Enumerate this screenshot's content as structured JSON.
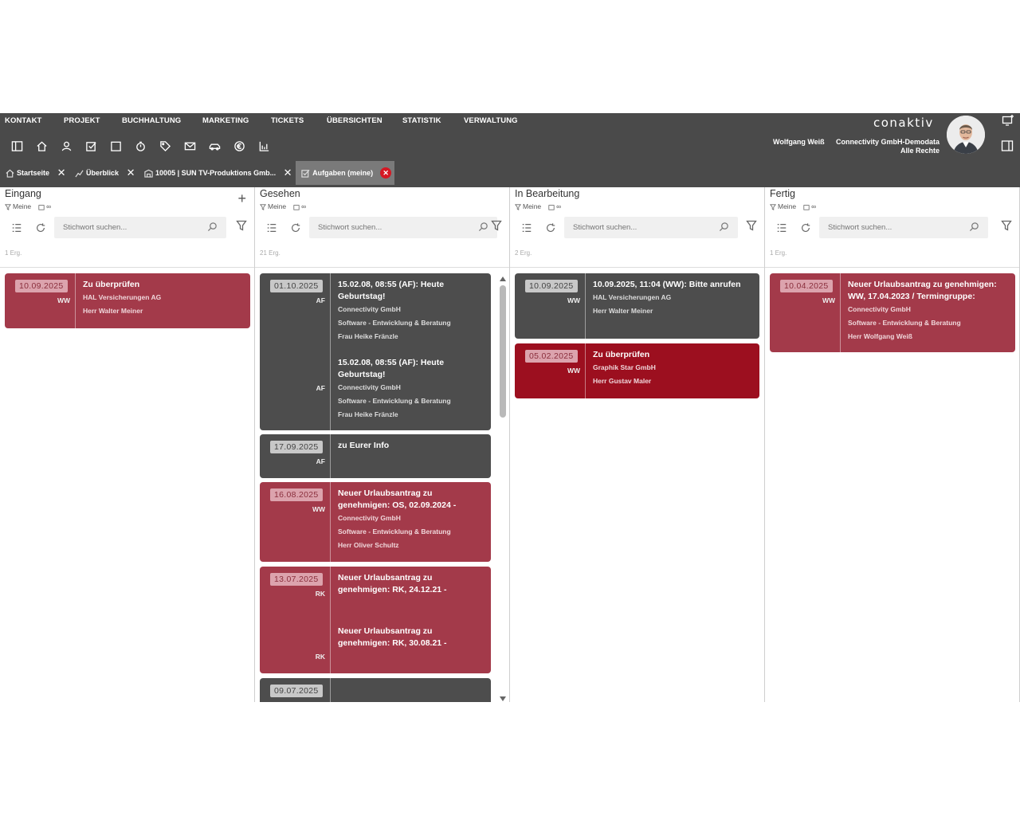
{
  "menu": [
    "KONTAKT",
    "PROJEKT",
    "BUCHHALTUNG",
    "MARKETING",
    "TICKETS",
    "ÜBERSICHTEN",
    "STATISTIK",
    "VERWALTUNG"
  ],
  "toolbar_icons": [
    "sidebar-toggle-icon",
    "home-icon",
    "contact-icon",
    "tasks-icon",
    "calendar-icon",
    "timer-icon",
    "tag-icon",
    "mail-icon",
    "car-icon",
    "euro-icon",
    "chart-icon"
  ],
  "brand": "conaktiv",
  "user": {
    "name": "Wolfgang Weiß",
    "company": "Connectivity GmbH-Demodata",
    "rights": "Alle Rechte"
  },
  "tabs": [
    {
      "label": "Startseite",
      "icon": "home-icon"
    },
    {
      "label": "Überblick",
      "icon": "chart-line-icon"
    },
    {
      "label": "10005 | SUN TV-Produktions Gmb...",
      "icon": "building-icon"
    },
    {
      "label": "Aufgaben (meine)",
      "icon": "tasks-icon",
      "active": true
    }
  ],
  "search_placeholder": "Stichwort suchen...",
  "filter_label": "Meine",
  "range_label": "∞",
  "columns": [
    {
      "title": "Eingang",
      "count": "1 Erg.",
      "cards": [
        {
          "color": "rose",
          "entries": [
            {
              "date": "10.09.2025",
              "initials": "WW",
              "title": "Zu überprüfen",
              "lines": [
                "HAL Versicherungen AG",
                "Herr Walter Meiner"
              ]
            }
          ]
        }
      ]
    },
    {
      "title": "Gesehen",
      "count": "21 Erg.",
      "cards": [
        {
          "color": "dark",
          "entries": [
            {
              "date": "01.10.2025",
              "initials": "AF",
              "title": "15.02.08, 08:55 (AF): Heute Geburtstag!",
              "lines": [
                "Connectivity GmbH",
                "Software - Entwicklung & Beratung",
                "Frau Heike Fränzle"
              ]
            },
            {
              "date": "",
              "initials": "AF",
              "title": "15.02.08, 08:55 (AF): Heute Geburtstag!",
              "lines": [
                "Connectivity GmbH",
                "Software - Entwicklung & Beratung",
                "Frau Heike Fränzle"
              ]
            }
          ]
        },
        {
          "color": "dark",
          "entries": [
            {
              "date": "17.09.2025",
              "initials": "AF",
              "title": "zu Eurer Info",
              "lines": []
            }
          ]
        },
        {
          "color": "rose",
          "entries": [
            {
              "date": "16.08.2025",
              "initials": "WW",
              "title": "Neuer Urlaubsantrag zu genehmigen: OS, 02.09.2024 -",
              "lines": [
                "Connectivity GmbH",
                "Software - Entwicklung & Beratung",
                "Herr Oliver Schultz"
              ]
            }
          ]
        },
        {
          "color": "rose",
          "entries": [
            {
              "date": "13.07.2025",
              "initials": "RK",
              "title": "Neuer Urlaubsantrag zu genehmigen: RK, 24.12.21 -",
              "lines": []
            },
            {
              "date": "",
              "initials": "RK",
              "title": "Neuer Urlaubsantrag zu genehmigen: RK, 30.08.21 -",
              "lines": []
            }
          ]
        },
        {
          "color": "dark",
          "entries": [
            {
              "date": "09.07.2025",
              "initials": "",
              "title": "",
              "lines": []
            }
          ]
        }
      ]
    },
    {
      "title": "In Bearbeitung",
      "count": "2 Erg.",
      "cards": [
        {
          "color": "dark",
          "entries": [
            {
              "date": "10.09.2025",
              "initials": "WW",
              "title": "10.09.2025, 11:04 (WW): Bitte anrufen",
              "lines": [
                "HAL Versicherungen AG",
                "Herr Walter Meiner"
              ]
            }
          ]
        },
        {
          "color": "crimson",
          "entries": [
            {
              "date": "05.02.2025",
              "initials": "WW",
              "title": "Zu überprüfen",
              "lines": [
                "Graphik Star GmbH",
                "Herr Gustav Maler"
              ]
            }
          ]
        }
      ]
    },
    {
      "title": "Fertig",
      "count": "1 Erg.",
      "cards": [
        {
          "color": "rose",
          "entries": [
            {
              "date": "10.04.2025",
              "initials": "WW",
              "title": "Neuer Urlaubsantrag zu genehmigen: WW, 17.04.2023 / Termingruppe:",
              "lines": [
                "Connectivity GmbH",
                "Software - Entwicklung & Beratung",
                "Herr Wolfgang Weiß"
              ]
            }
          ]
        }
      ]
    }
  ],
  "colors": {
    "header": "#4a4a4a",
    "card_dark": "#4d4d4d",
    "card_rose": "#a33a4a",
    "card_crimson": "#9c0f1f",
    "close_red": "#d51823"
  }
}
